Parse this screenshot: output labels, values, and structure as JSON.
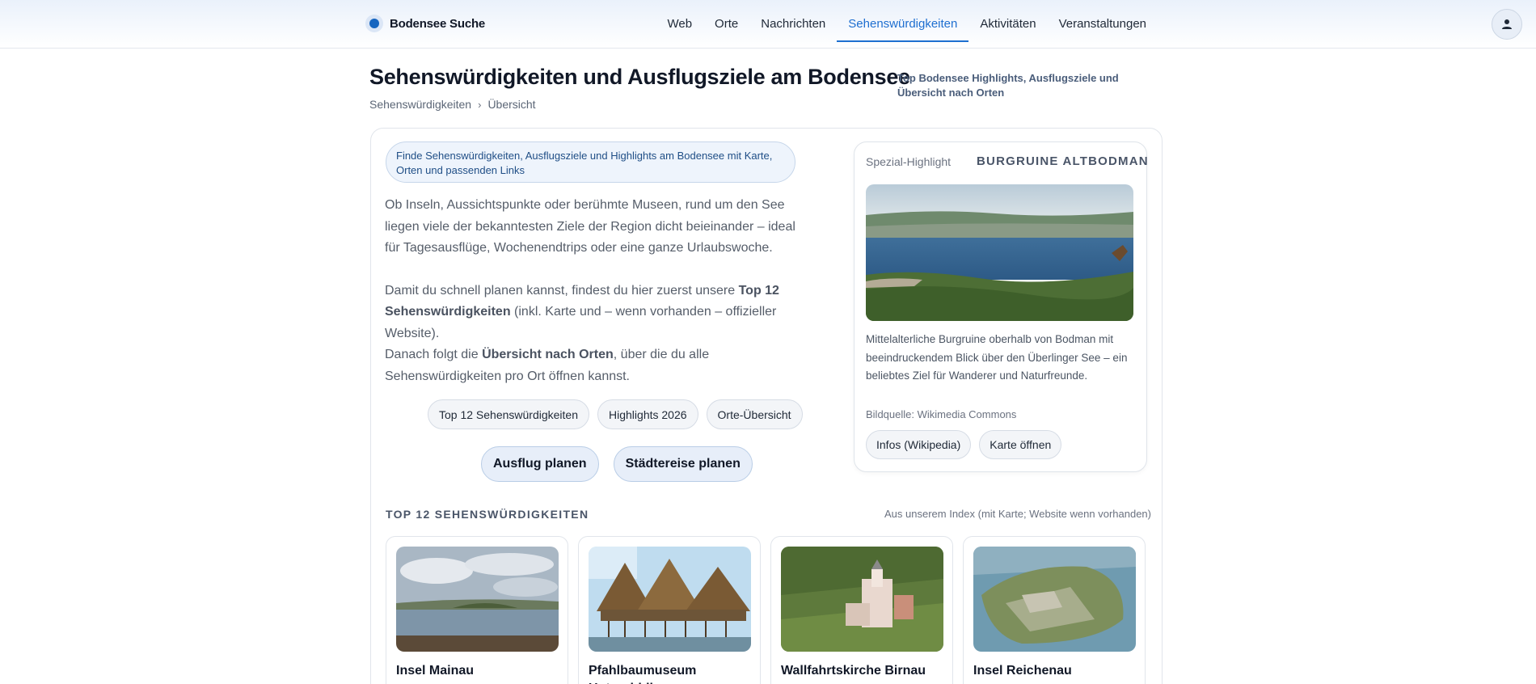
{
  "header": {
    "brand": "Bodensee Suche",
    "nav": [
      "Web",
      "Orte",
      "Nachrichten",
      "Sehenswürdigkeiten",
      "Aktivitäten",
      "Veranstaltungen"
    ],
    "active_nav": "Sehenswürdigkeiten",
    "profile_icon": "user-icon"
  },
  "page": {
    "title": "Sehenswürdigkeiten und Ausflugsziele am Bodensee",
    "subtitle": "Top Bodensee Highlights, Ausflugsziele und Übersicht nach Orten",
    "breadcrumb": [
      "Sehenswürdigkeiten",
      "Übersicht"
    ]
  },
  "intro": {
    "pill": "Finde Sehenswürdigkeiten, Ausflugsziele und Highlights am Bodensee mit Karte, Orten und passenden Links",
    "p1": "Ob Inseln, Aussichtspunkte oder berühmte Museen, rund um den See liegen viele der bekanntesten Ziele der Region dicht beieinander – ideal für Tagesausflüge, Wochenendtrips oder eine ganze Urlaubswoche.",
    "p2_a": "Damit du schnell planen kannst, findest du hier zuerst unsere ",
    "p2_b": "Top 12 Sehenswürdigkeiten",
    "p2_c": " (inkl. Karte und – wenn vorhanden – offizieller Website).",
    "p3_a": "Danach folgt die ",
    "p3_b": "Übersicht nach Orten",
    "p3_c": ", über die du alle Sehenswürdigkeiten pro Ort öffnen kannst."
  },
  "chips": [
    "Top 12 Sehenswürdigkeiten",
    "Highlights 2026",
    "Orte-Übersicht"
  ],
  "ctas": [
    "Ausflug planen",
    "Städtereise planen"
  ],
  "highlight": {
    "label": "Spezial-Highlight",
    "name": "BURGRUINE ALTBODMAN",
    "description": "Mittelalterliche Burgruine oberhalb von Bodman mit beeindruckendem Blick über den Überlinger See – ein beliebtes Ziel für Wanderer und Naturfreunde.",
    "source": "Bildquelle: Wikimedia Commons",
    "buttons": [
      "Infos (Wikipedia)",
      "Karte öffnen"
    ]
  },
  "top12": {
    "title": "TOP 12 SEHENSWÜRDIGKEITEN",
    "subtitle": "Aus unserem Index (mit Karte; Website wenn vorhanden)",
    "items": [
      {
        "name": "Insel Mainau"
      },
      {
        "name": "Pfahlbaumuseum Unteruhldingen"
      },
      {
        "name": "Wallfahrtskirche Birnau"
      },
      {
        "name": "Insel Reichenau"
      }
    ]
  }
}
